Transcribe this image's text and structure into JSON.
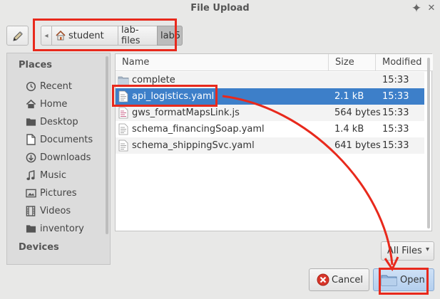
{
  "window": {
    "title": "File Upload",
    "pin_glyph": "✦",
    "close_glyph": "✕"
  },
  "pathbar": {
    "back_glyph": "◂",
    "crumbs": [
      "student",
      "lab-files",
      "lab5"
    ]
  },
  "places": {
    "header": "Places",
    "items": [
      {
        "label": "Recent",
        "icon": "clock-icon"
      },
      {
        "label": "Home",
        "icon": "home-icon"
      },
      {
        "label": "Desktop",
        "icon": "folder-icon"
      },
      {
        "label": "Documents",
        "icon": "document-icon"
      },
      {
        "label": "Downloads",
        "icon": "download-icon"
      },
      {
        "label": "Music",
        "icon": "music-note-icon"
      },
      {
        "label": "Pictures",
        "icon": "picture-icon"
      },
      {
        "label": "Videos",
        "icon": "film-icon"
      },
      {
        "label": "inventory",
        "icon": "folder-icon"
      }
    ],
    "devices_header": "Devices"
  },
  "files": {
    "columns": [
      "Name",
      "Size",
      "Modified"
    ],
    "rows": [
      {
        "name": "complete",
        "size": "",
        "modified": "15:33",
        "type": "folder"
      },
      {
        "name": "api_logistics.yaml",
        "size": "2.1 kB",
        "modified": "15:33",
        "type": "file",
        "selected": true
      },
      {
        "name": "gws_formatMapsLink.js",
        "size": "564 bytes",
        "modified": "15:33",
        "type": "file"
      },
      {
        "name": "schema_financingSoap.yaml",
        "size": "1.4 kB",
        "modified": "15:33",
        "type": "file"
      },
      {
        "name": "schema_shippingSvc.yaml",
        "size": "641 bytes",
        "modified": "15:33",
        "type": "file"
      }
    ]
  },
  "filter": {
    "label": "All Files",
    "dropdown_glyph": "▾"
  },
  "buttons": {
    "cancel": "Cancel",
    "open": "Open"
  },
  "colors": {
    "selection": "#3d7fc9",
    "annotation": "#e8291c"
  }
}
